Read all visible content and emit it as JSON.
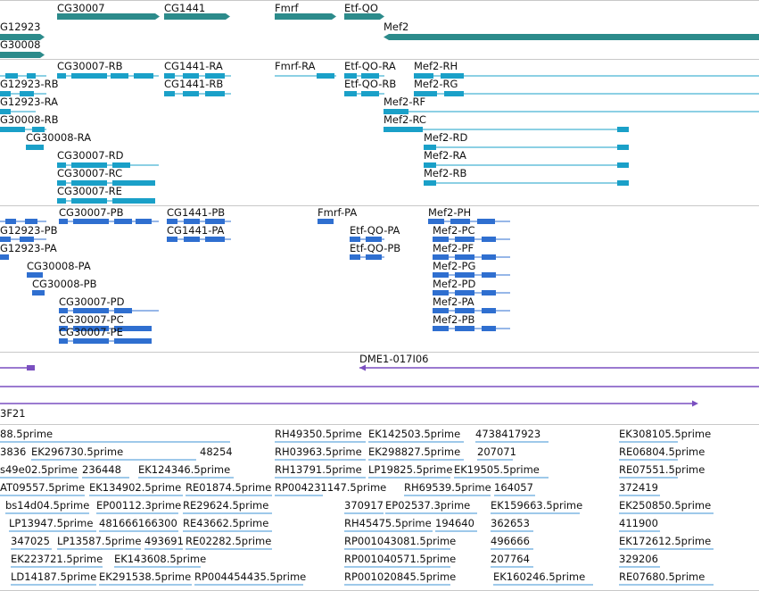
{
  "colors": {
    "gene": "#2c8b8b",
    "transcript": "#1aa0c8",
    "protein": "#2f6fd0",
    "clone": "#7a4fc0",
    "est": "#7fb7e3",
    "divider": "#c8c8c8"
  },
  "tracks": {
    "genes": {
      "items": [
        {
          "label": "CG30007",
          "icon": "gene-arrow-icon"
        },
        {
          "label": "CG1441",
          "icon": "gene-arrow-icon"
        },
        {
          "label": "Fmrf",
          "icon": "gene-arrow-icon"
        },
        {
          "label": "Etf-QO",
          "icon": "gene-arrow-icon"
        },
        {
          "label": "Mef2",
          "icon": "gene-arrow-icon"
        },
        {
          "label": "G12923",
          "icon": "gene-arrow-icon"
        },
        {
          "label": "G30008",
          "icon": "gene-arrow-icon"
        }
      ]
    },
    "transcripts": {
      "items": [
        {
          "label": "CG30007-RB"
        },
        {
          "label": "CG1441-RA"
        },
        {
          "label": "Fmrf-RA"
        },
        {
          "label": "Etf-QO-RA"
        },
        {
          "label": "Mef2-RH"
        },
        {
          "label": "G12923-RB"
        },
        {
          "label": "CG1441-RB"
        },
        {
          "label": "Etf-QO-RB"
        },
        {
          "label": "Mef2-RG"
        },
        {
          "label": "G12923-RA"
        },
        {
          "label": "Mef2-RF"
        },
        {
          "label": "G30008-RB"
        },
        {
          "label": "Mef2-RC"
        },
        {
          "label": "CG30008-RA"
        },
        {
          "label": "Mef2-RD"
        },
        {
          "label": "CG30007-RD"
        },
        {
          "label": "Mef2-RA"
        },
        {
          "label": "CG30007-RC"
        },
        {
          "label": "Mef2-RB"
        },
        {
          "label": "CG30007-RE"
        }
      ]
    },
    "proteins": {
      "items": [
        {
          "label": "CG30007-PB"
        },
        {
          "label": "CG1441-PB"
        },
        {
          "label": "Fmrf-PA"
        },
        {
          "label": "Mef2-PH"
        },
        {
          "label": "G12923-PB"
        },
        {
          "label": "CG1441-PA"
        },
        {
          "label": "Etf-QO-PA"
        },
        {
          "label": "Mef2-PC"
        },
        {
          "label": "G12923-PA"
        },
        {
          "label": "Etf-QO-PB"
        },
        {
          "label": "Mef2-PF"
        },
        {
          "label": "CG30008-PA"
        },
        {
          "label": "Mef2-PG"
        },
        {
          "label": "CG30008-PB"
        },
        {
          "label": "Mef2-PD"
        },
        {
          "label": "CG30007-PD"
        },
        {
          "label": "Mef2-PA"
        },
        {
          "label": "CG30007-PC"
        },
        {
          "label": "Mef2-PB"
        },
        {
          "label": "CG30007-PE"
        }
      ]
    },
    "clones": {
      "items": [
        {
          "label": "DME1-017I06"
        },
        {
          "label": "3F21"
        }
      ]
    },
    "ests": {
      "items": [
        {
          "label": "88.5prime"
        },
        {
          "label": "RH49350.5prime"
        },
        {
          "label": "EK142503.5prime"
        },
        {
          "label": "4738417923"
        },
        {
          "label": "EK308105.5prime"
        },
        {
          "label": "3836"
        },
        {
          "label": "EK296730.5prime"
        },
        {
          "label": "48254"
        },
        {
          "label": "RH03963.5prime"
        },
        {
          "label": "EK298827.5prime"
        },
        {
          "label": "207071"
        },
        {
          "label": "RE06804.5prime"
        },
        {
          "label": "s49e02.5prime"
        },
        {
          "label": "236448"
        },
        {
          "label": "EK124346.5prime"
        },
        {
          "label": "RH13791.5prime"
        },
        {
          "label": "LP19825.5prime"
        },
        {
          "label": "EK19505.5prime"
        },
        {
          "label": "RE07551.5prime"
        },
        {
          "label": "AT09557.5prime"
        },
        {
          "label": "EK134902.5prime"
        },
        {
          "label": "RE01874.5prime"
        },
        {
          "label": "RP004231147.5prime"
        },
        {
          "label": "RH69539.5prime"
        },
        {
          "label": "164057"
        },
        {
          "label": "372419"
        },
        {
          "label": "bs14d04.5prime"
        },
        {
          "label": "EP00112.3prime"
        },
        {
          "label": "RE29624.5prime"
        },
        {
          "label": "370917"
        },
        {
          "label": "EP02537.3prime"
        },
        {
          "label": "EK159663.5prime"
        },
        {
          "label": "EK250850.5prime"
        },
        {
          "label": "LP13947.5prime"
        },
        {
          "label": "481666166300"
        },
        {
          "label": "RE43662.5prime"
        },
        {
          "label": "RH45475.5prime"
        },
        {
          "label": "194640"
        },
        {
          "label": "362653"
        },
        {
          "label": "411900"
        },
        {
          "label": "347025"
        },
        {
          "label": "LP13587.5prime"
        },
        {
          "label": "493691"
        },
        {
          "label": "RE02282.5prime"
        },
        {
          "label": "RP001043081.5prime"
        },
        {
          "label": "496666"
        },
        {
          "label": "EK172612.5prime"
        },
        {
          "label": "EK223721.5prime"
        },
        {
          "label": "EK143608.5prime"
        },
        {
          "label": "RP001040571.5prime"
        },
        {
          "label": "207764"
        },
        {
          "label": "329206"
        },
        {
          "label": "LD14187.5prime"
        },
        {
          "label": "EK291538.5prime"
        },
        {
          "label": "RP004454435.5prime"
        },
        {
          "label": "RP001020845.5prime"
        },
        {
          "label": "EK160246.5prime"
        },
        {
          "label": "RE07680.5prime"
        }
      ]
    }
  }
}
